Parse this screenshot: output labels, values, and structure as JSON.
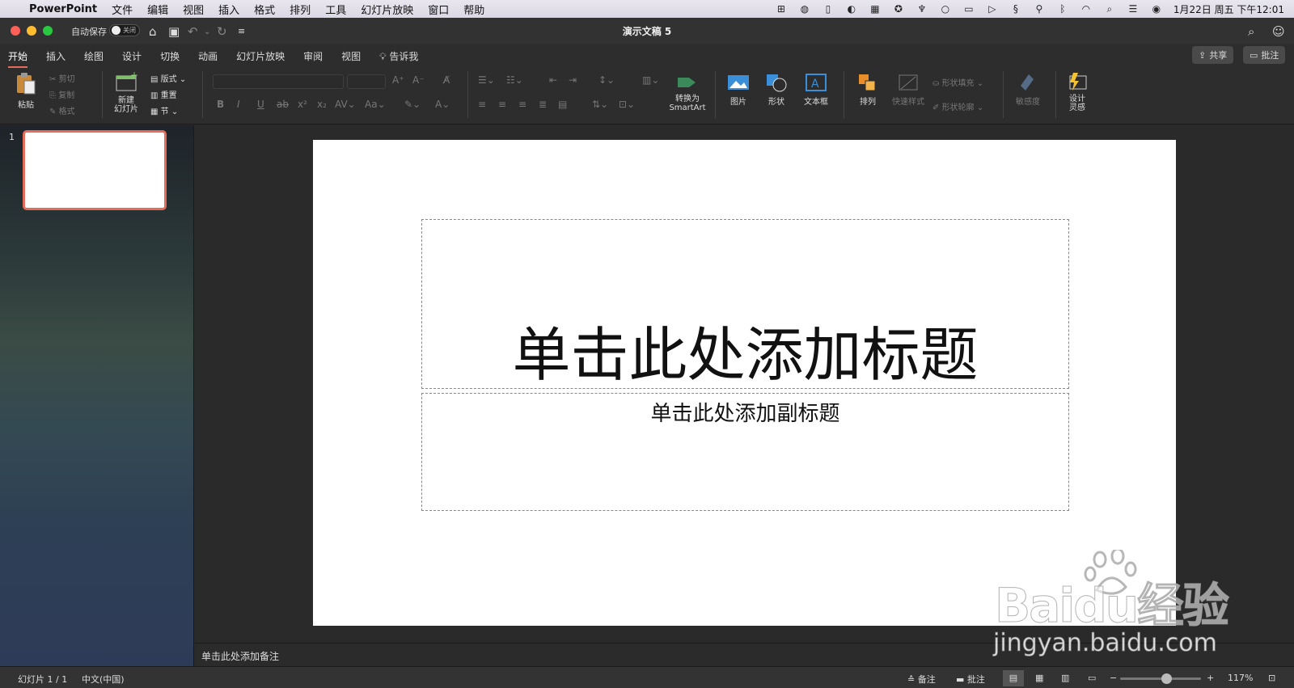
{
  "menubar": {
    "app_name": "PowerPoint",
    "items": [
      "文件",
      "编辑",
      "视图",
      "插入",
      "格式",
      "排列",
      "工具",
      "幻灯片放映",
      "窗口",
      "帮助"
    ],
    "datetime": "1月22日 周五 下午12:01",
    "status_icons": [
      "input-method-icon",
      "wechat-icon",
      "battery-icon",
      "sync-icon",
      "grid-icon",
      "app-icon",
      "feather-icon",
      "circle-icon",
      "camera-icon",
      "play-icon",
      "s-icon",
      "mic-icon",
      "bluetooth-icon",
      "wifi-icon",
      "search-icon",
      "control-center-icon",
      "siri-icon"
    ]
  },
  "titlebar": {
    "autosave_label": "自动保存",
    "autosave_state": "关闭",
    "document_title": "演示文稿 5"
  },
  "tabs": {
    "items": [
      "开始",
      "插入",
      "绘图",
      "设计",
      "切换",
      "动画",
      "幻灯片放映",
      "审阅",
      "视图"
    ],
    "active": "开始",
    "tell_me": "告诉我",
    "share": "共享",
    "comments": "批注"
  },
  "ribbon": {
    "paste": "粘贴",
    "cut": "剪切",
    "copy": "复制",
    "format": "格式",
    "new_slide": "新建\n幻灯片",
    "layout": "版式",
    "reset": "重置",
    "section": "节",
    "convert_smartart_1": "转换为",
    "convert_smartart_2": "SmartArt",
    "picture": "图片",
    "shape": "形状",
    "textbox": "文本框",
    "arrange": "排列",
    "quick_styles": "快速样式",
    "shape_fill": "形状填充",
    "shape_outline": "形状轮廓",
    "sensitivity": "敏感度",
    "designer_1": "设计",
    "designer_2": "灵感"
  },
  "thumbnails": [
    {
      "number": "1",
      "selected": true
    }
  ],
  "slide": {
    "title_placeholder": "单击此处添加标题",
    "subtitle_placeholder": "单击此处添加副标题"
  },
  "notes": {
    "placeholder": "单击此处添加备注"
  },
  "statusbar": {
    "slide_counter": "幻灯片 1 / 1",
    "language": "中文(中国)",
    "notes_label": "备注",
    "comments_label": "批注",
    "zoom_level": "117%"
  },
  "watermark": {
    "brand": "Baidu经验",
    "url": "jingyan.baidu.com"
  },
  "colors": {
    "accent": "#e56c58",
    "window_bg": "#2a2a2a",
    "slide_bg": "#ffffff"
  }
}
